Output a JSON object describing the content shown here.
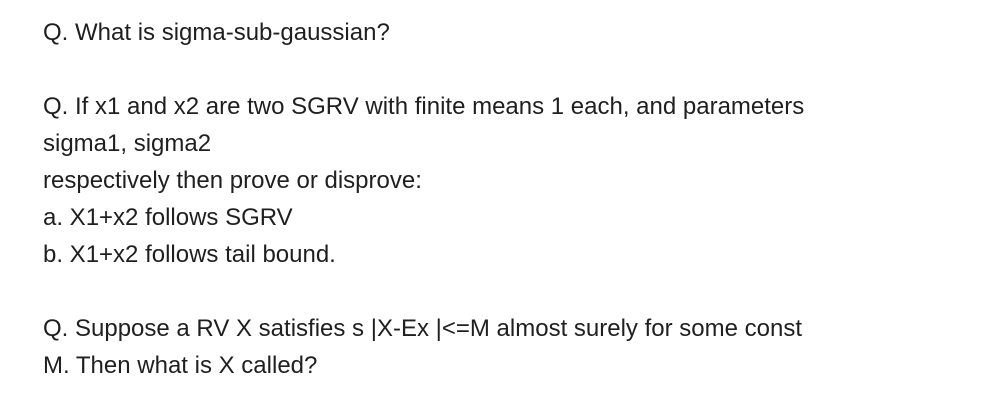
{
  "questions": [
    {
      "lines": [
        "Q. What is sigma-sub-gaussian?"
      ]
    },
    {
      "lines": [
        "Q. If x1 and x2 are two SGRV with finite means 1 each, and parameters",
        "sigma1, sigma2",
        "respectively then prove or disprove:",
        "a. X1+x2 follows SGRV",
        "b. X1+x2 follows tail bound."
      ]
    },
    {
      "lines": [
        "Q. Suppose a RV X satisfies s |X-Ex |<=M almost surely for some const",
        "M. Then what is X called?"
      ]
    }
  ]
}
